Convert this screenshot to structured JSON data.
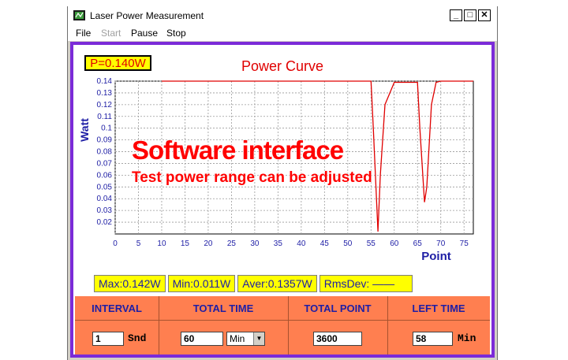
{
  "window": {
    "title": "Laser Power Measurement",
    "minimize": "_",
    "maximize": "□",
    "close": "✕"
  },
  "menu": [
    {
      "label": "File",
      "enabled": true
    },
    {
      "label": "Start",
      "enabled": false
    },
    {
      "label": "Pause",
      "enabled": true
    },
    {
      "label": "Stop",
      "enabled": true
    }
  ],
  "power_readout": "P=0.140W",
  "overlay": {
    "headline": "Software interface",
    "subline": "Test power range can be adjusted"
  },
  "chart_data": {
    "type": "line",
    "title": "Power Curve",
    "xlabel": "Point",
    "ylabel": "Watt",
    "xlim": [
      0,
      77
    ],
    "ylim": [
      0.01,
      0.14
    ],
    "xticks": [
      0,
      5,
      10,
      15,
      20,
      25,
      30,
      35,
      40,
      45,
      50,
      55,
      60,
      65,
      70,
      75
    ],
    "yticks": [
      0.02,
      0.03,
      0.04,
      0.05,
      0.06,
      0.07,
      0.08,
      0.09,
      0.1,
      0.11,
      0.12,
      0.13,
      0.14
    ],
    "grid": true,
    "line_color": "#e00000",
    "series": [
      {
        "x": [
          10,
          11,
          25,
          30,
          55,
          55.5,
          56.5,
          57,
          58,
          60,
          65,
          65.5,
          66.5,
          67,
          68,
          69,
          70,
          77
        ],
        "y": [
          0.14,
          0.14,
          0.14,
          0.14,
          0.14,
          0.1,
          0.012,
          0.06,
          0.12,
          0.139,
          0.139,
          0.1,
          0.037,
          0.05,
          0.12,
          0.139,
          0.14,
          0.14
        ]
      }
    ]
  },
  "stats": {
    "max": "Max:0.142W",
    "min": "Min:0.011W",
    "aver": "Aver:0.1357W",
    "rmsdev": "RmsDev: ——"
  },
  "controls": {
    "interval": {
      "header": "INTERVAL",
      "value": "1",
      "unit": "Snd"
    },
    "total_time": {
      "header": "TOTAL TIME",
      "value": "60",
      "unit": "Min"
    },
    "total_point": {
      "header": "TOTAL POINT",
      "value": "3600"
    },
    "left_time": {
      "header": "LEFT TIME",
      "value": "58",
      "unit": "Min"
    }
  }
}
